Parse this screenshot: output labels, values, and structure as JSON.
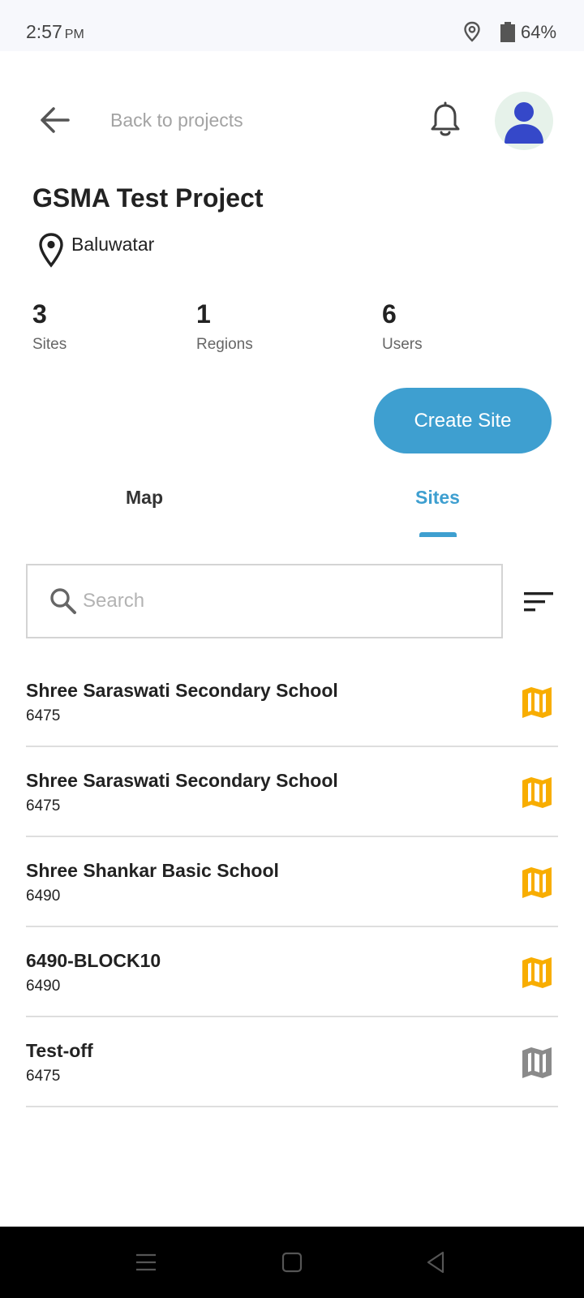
{
  "status_bar": {
    "time": "2:57",
    "ampm": "PM",
    "battery": "64%",
    "icons": [
      "location-icon",
      "battery-icon"
    ]
  },
  "header": {
    "back_label": "Back to projects",
    "icons": [
      "arrow-back-icon",
      "bell-icon",
      "avatar-user-icon"
    ]
  },
  "project": {
    "title": "GSMA Test Project",
    "location": "Baluwatar"
  },
  "stats": [
    {
      "value": "3",
      "label": "Sites"
    },
    {
      "value": "1",
      "label": "Regions"
    },
    {
      "value": "6",
      "label": "Users"
    }
  ],
  "actions": {
    "create_site": "Create Site"
  },
  "tabs": [
    {
      "label": "Map",
      "active": false
    },
    {
      "label": "Sites",
      "active": true
    }
  ],
  "search": {
    "placeholder": "Search",
    "value": ""
  },
  "sites": [
    {
      "name": "Shree Saraswati Secondary School",
      "code": "6475",
      "map_icon_color": "#f8ad00"
    },
    {
      "name": "Shree Saraswati Secondary School",
      "code": "6475",
      "map_icon_color": "#f8ad00"
    },
    {
      "name": "Shree Shankar Basic School",
      "code": "6490",
      "map_icon_color": "#f8ad00"
    },
    {
      "name": "6490-BLOCK10",
      "code": "6490",
      "map_icon_color": "#f8ad00"
    },
    {
      "name": "Test-off",
      "code": "6475",
      "map_icon_color": "#8a8a8a"
    }
  ],
  "colors": {
    "accent": "#3e9fd0",
    "map_icon_active": "#f8ad00",
    "map_icon_inactive": "#8a8a8a"
  },
  "nav": {
    "icons": [
      "menu-icon",
      "home-square-icon",
      "back-triangle-icon"
    ]
  }
}
